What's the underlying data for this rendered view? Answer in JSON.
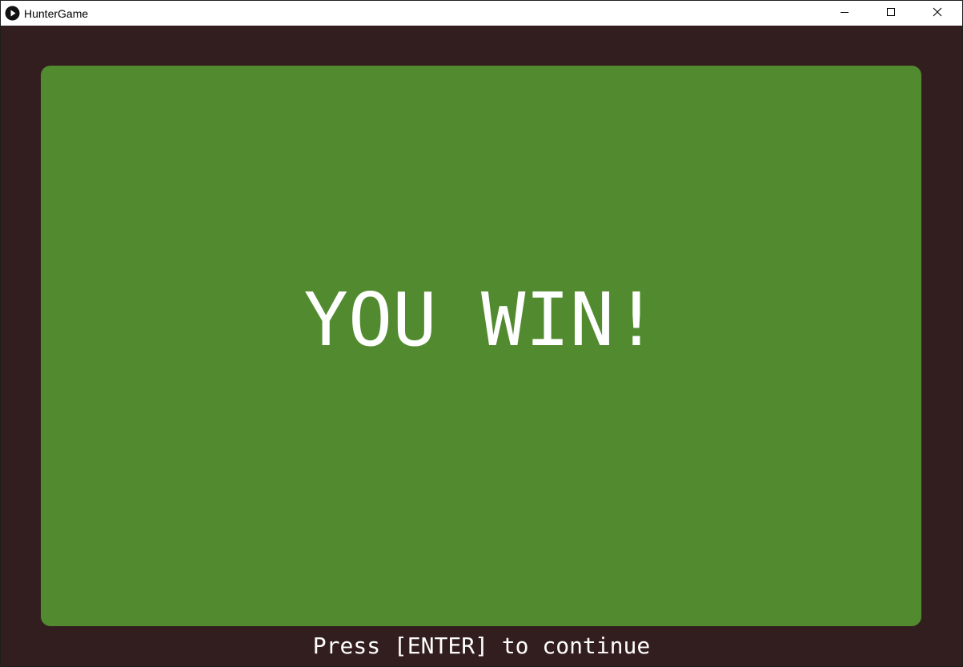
{
  "window": {
    "title": "HunterGame",
    "icon": "play-circle-icon",
    "controls": {
      "minimize": "minimize-icon",
      "maximize": "maximize-icon",
      "close": "close-icon"
    }
  },
  "game": {
    "headline": "YOU WIN!",
    "prompt": "Press [ENTER] to continue"
  },
  "colors": {
    "background": "#331e1f",
    "panel": "#528b2f",
    "text": "#ffffff"
  }
}
